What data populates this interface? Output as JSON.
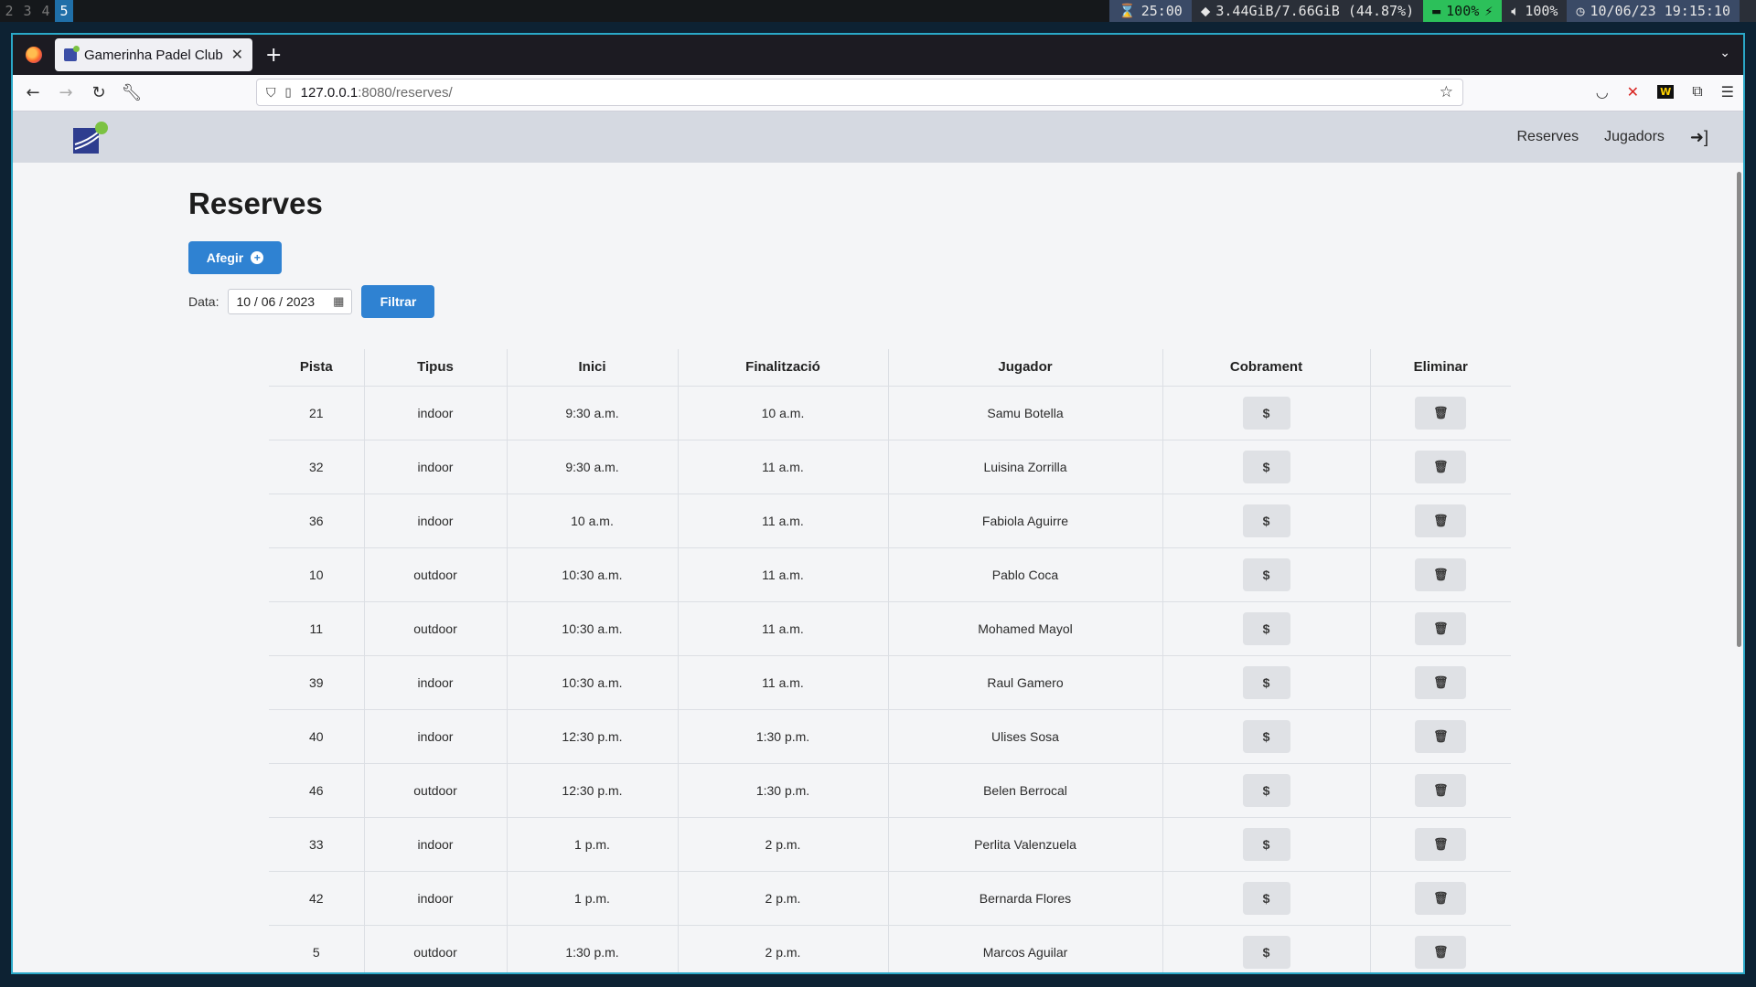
{
  "system_bar": {
    "workspaces": [
      "2",
      "3",
      "4",
      "5"
    ],
    "active_workspace": "5",
    "timer": "25:00",
    "memory": "3.44GiB/7.66GiB (44.87%)",
    "battery": "100%",
    "volume": "100%",
    "clock": "10/06/23 19:15:10"
  },
  "browser": {
    "tab_title": "Gamerinha Padel Club",
    "url_host": "127.0.0.1",
    "url_rest": ":8080/reserves/"
  },
  "app": {
    "nav": {
      "reserves": "Reserves",
      "jugadors": "Jugadors"
    }
  },
  "page": {
    "title": "Reserves",
    "add_button": "Afegir",
    "date_label": "Data:",
    "date_value": "10 / 06 / 2023",
    "filter_button": "Filtrar"
  },
  "table": {
    "headers": [
      "Pista",
      "Tipus",
      "Inici",
      "Finalització",
      "Jugador",
      "Cobrament",
      "Eliminar"
    ],
    "pay_label": "$",
    "rows": [
      {
        "pista": "21",
        "tipus": "indoor",
        "inici": "9:30 a.m.",
        "fi": "10 a.m.",
        "jugador": "Samu Botella"
      },
      {
        "pista": "32",
        "tipus": "indoor",
        "inici": "9:30 a.m.",
        "fi": "11 a.m.",
        "jugador": "Luisina Zorrilla"
      },
      {
        "pista": "36",
        "tipus": "indoor",
        "inici": "10 a.m.",
        "fi": "11 a.m.",
        "jugador": "Fabiola Aguirre"
      },
      {
        "pista": "10",
        "tipus": "outdoor",
        "inici": "10:30 a.m.",
        "fi": "11 a.m.",
        "jugador": "Pablo Coca"
      },
      {
        "pista": "11",
        "tipus": "outdoor",
        "inici": "10:30 a.m.",
        "fi": "11 a.m.",
        "jugador": "Mohamed Mayol"
      },
      {
        "pista": "39",
        "tipus": "indoor",
        "inici": "10:30 a.m.",
        "fi": "11 a.m.",
        "jugador": "Raul Gamero"
      },
      {
        "pista": "40",
        "tipus": "indoor",
        "inici": "12:30 p.m.",
        "fi": "1:30 p.m.",
        "jugador": "Ulises Sosa"
      },
      {
        "pista": "46",
        "tipus": "outdoor",
        "inici": "12:30 p.m.",
        "fi": "1:30 p.m.",
        "jugador": "Belen Berrocal"
      },
      {
        "pista": "33",
        "tipus": "indoor",
        "inici": "1 p.m.",
        "fi": "2 p.m.",
        "jugador": "Perlita Valenzuela"
      },
      {
        "pista": "42",
        "tipus": "indoor",
        "inici": "1 p.m.",
        "fi": "2 p.m.",
        "jugador": "Bernarda Flores"
      },
      {
        "pista": "5",
        "tipus": "outdoor",
        "inici": "1:30 p.m.",
        "fi": "2 p.m.",
        "jugador": "Marcos Aguilar"
      }
    ]
  },
  "colors": {
    "primary": "#2f82d2",
    "header_bg": "#d5d9e1",
    "battery_bg": "#2cc05a",
    "window_border": "#2aa8c8"
  }
}
